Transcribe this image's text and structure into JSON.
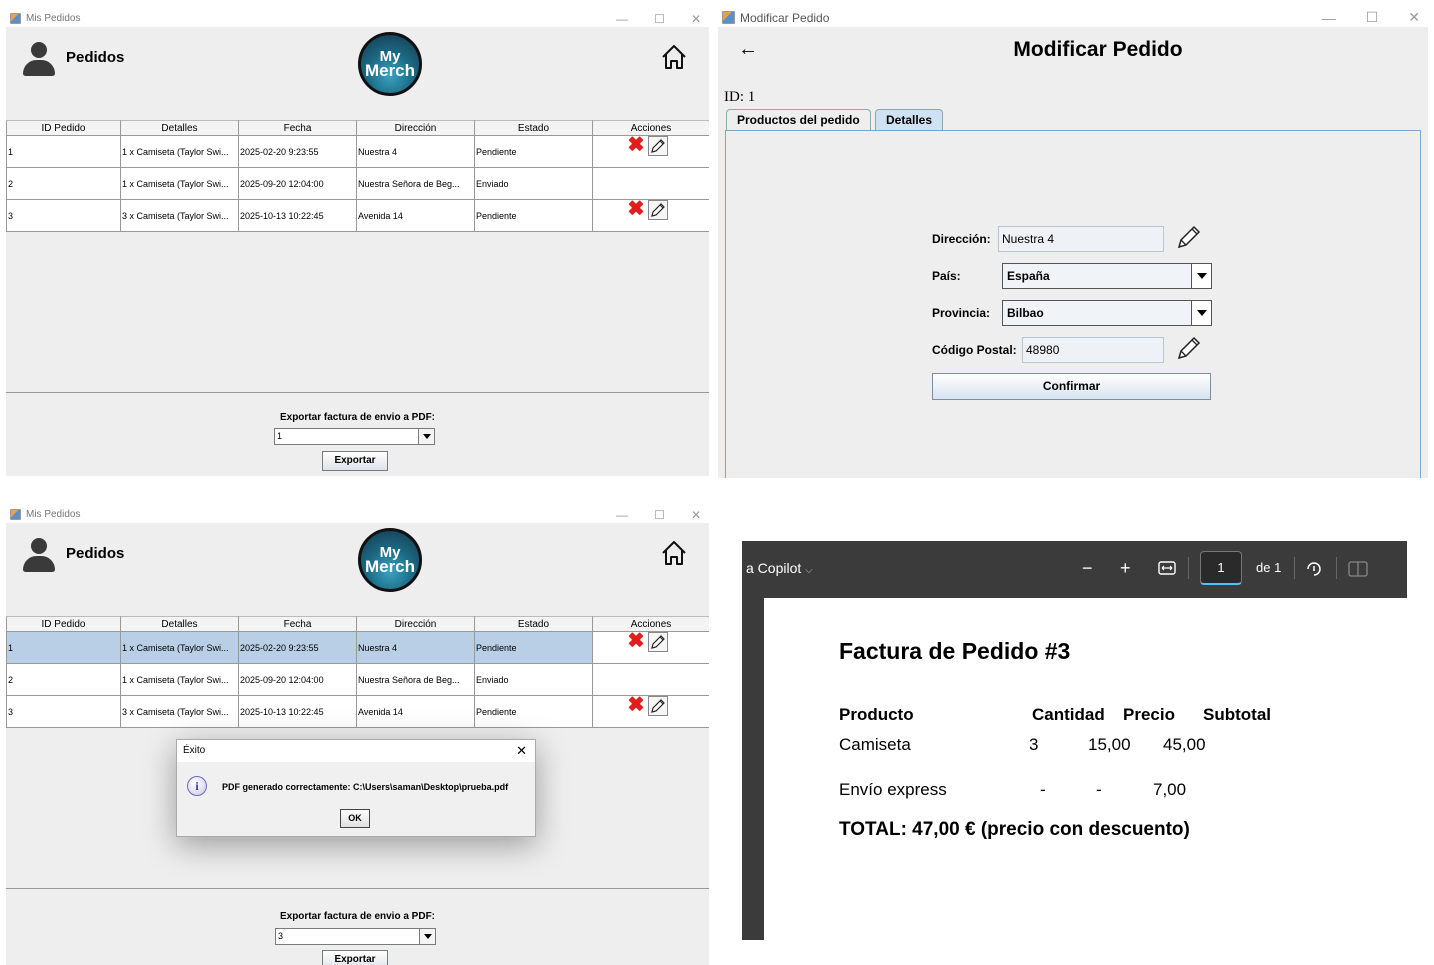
{
  "orders_window": {
    "title": "Mis Pedidos",
    "header_title": "Pedidos",
    "logo": {
      "line1": "My",
      "line2": "Merch"
    },
    "columns": [
      "ID Pedido",
      "Detalles",
      "Fecha",
      "Dirección",
      "Estado",
      "Acciones"
    ],
    "rows": [
      {
        "id": "1",
        "details": "1 x Camiseta (Taylor Swi...",
        "date": "2025-02-20 9:23:55",
        "address": "Nuestra 4",
        "status": "Pendiente",
        "actions": true
      },
      {
        "id": "2",
        "details": "1 x Camiseta (Taylor Swi...",
        "date": "2025-09-20 12:04:00",
        "address": "Nuestra Señora de Beg...",
        "status": "Enviado",
        "actions": false
      },
      {
        "id": "3",
        "details": "3 x Camiseta (Taylor Swi...",
        "date": "2025-10-13 10:22:45",
        "address": "Avenida 14",
        "status": "Pendiente",
        "actions": true
      }
    ],
    "export_label": "Exportar factura de envio a PDF:",
    "export_selected": "1",
    "export_button": "Exportar"
  },
  "orders_window_2": {
    "title": "Mis Pedidos",
    "header_title": "Pedidos",
    "logo": {
      "line1": "My",
      "line2": "Merch"
    },
    "columns": [
      "ID Pedido",
      "Detalles",
      "Fecha",
      "Dirección",
      "Estado",
      "Acciones"
    ],
    "rows": [
      {
        "id": "1",
        "details": "1 x Camiseta (Taylor Swi...",
        "date": "2025-02-20 9:23:55",
        "address": "Nuestra 4",
        "status": "Pendiente",
        "actions": true
      },
      {
        "id": "2",
        "details": "1 x Camiseta (Taylor Swi...",
        "date": "2025-09-20 12:04:00",
        "address": "Nuestra Señora de Beg...",
        "status": "Enviado",
        "actions": false
      },
      {
        "id": "3",
        "details": "3 x Camiseta (Taylor Swi...",
        "date": "2025-10-13 10:22:45",
        "address": "Avenida 14",
        "status": "Pendiente",
        "actions": true
      }
    ],
    "export_label": "Exportar factura de envio a PDF:",
    "export_selected": "3",
    "export_button": "Exportar",
    "dialog": {
      "title": "Éxito",
      "message": "PDF generado correctamente: C:\\Users\\saman\\Desktop\\prueba.pdf",
      "ok": "OK"
    }
  },
  "modify_window": {
    "title": "Modificar Pedido",
    "back": "←",
    "heading": "Modificar Pedido",
    "id_label": "ID: 1",
    "tabs": [
      "Productos del pedido",
      "Detalles"
    ],
    "active_tab": "Detalles",
    "address_label": "Dirección:",
    "address_value": "Nuestra 4",
    "country_label": "País:",
    "country_value": "España",
    "province_label": "Provincia:",
    "province_value": "Bilbao",
    "postal_label": "Código Postal:",
    "postal_value": "48980",
    "confirm": "Confirmar"
  },
  "pdf_viewer": {
    "toolbar_left": "a Copilot",
    "page_current": "1",
    "page_total": "de 1",
    "invoice_title": "Factura de Pedido #3",
    "columns": [
      "Producto",
      "Cantidad",
      "Precio",
      "Subtotal"
    ],
    "rows": [
      [
        "Camiseta",
        "3",
        "15,00",
        "45,00"
      ],
      [
        "Envío express",
        "-",
        "-",
        "7,00"
      ]
    ],
    "total": "TOTAL: 47,00 € (precio con descuento)"
  },
  "colors": {
    "selected_row": "#b8cfe5",
    "delete_red": "#e51c1c",
    "active_tab": "#cfe2f3",
    "pdf_toolbar": "#3b3b3b"
  }
}
